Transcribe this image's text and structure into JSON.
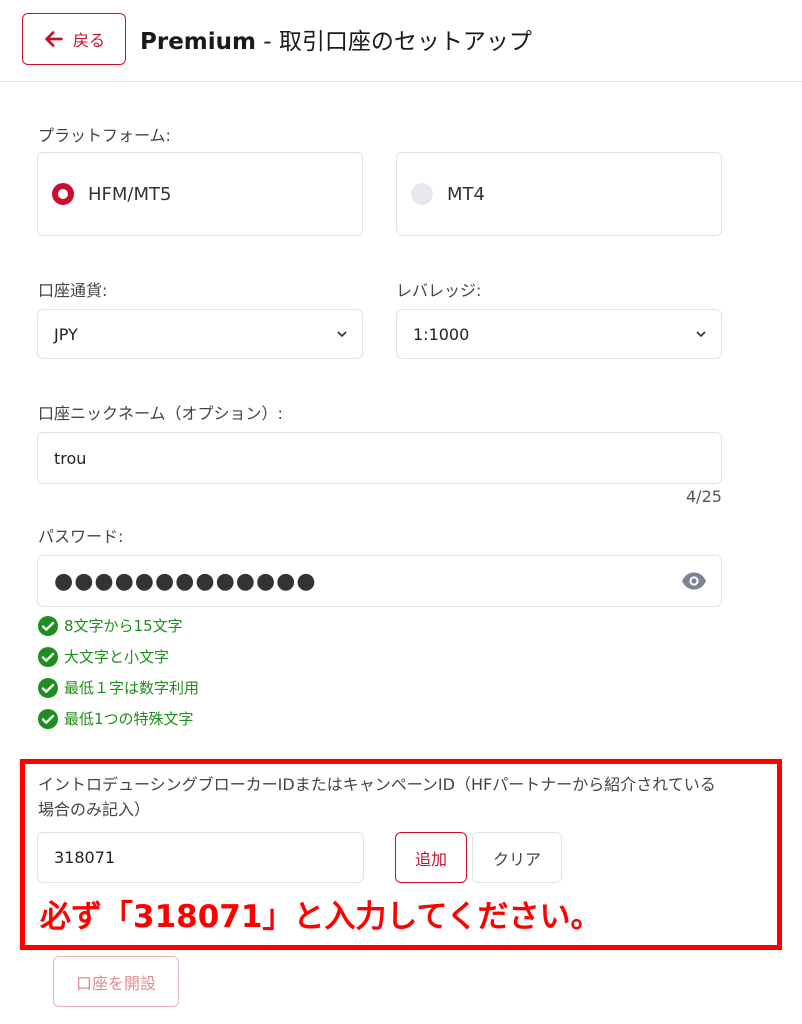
{
  "header": {
    "back_label": "戻る",
    "title_bold": "Premium",
    "title_rest": " - 取引口座のセットアップ"
  },
  "platform": {
    "label": "プラットフォーム:",
    "options": [
      {
        "label": "HFM/MT5",
        "selected": true
      },
      {
        "label": "MT4",
        "selected": false
      }
    ]
  },
  "currency": {
    "label": "口座通貨:",
    "value": "JPY"
  },
  "leverage": {
    "label": "レバレッジ:",
    "value": "1:1000"
  },
  "nickname": {
    "label": "口座ニックネーム（オプション）:",
    "value": "trou",
    "counter": "4/25"
  },
  "password": {
    "label": "パスワード:",
    "value": "●●●●●●●●●●●●●",
    "rules": [
      "8文字から15文字",
      "大文字と小文字",
      "最低１字は数字利用",
      "最低1つの特殊文字"
    ]
  },
  "ib": {
    "label": "イントロデューシングブローカーIDまたはキャンペーンID（HFパートナーから紹介されている場合のみ記入）",
    "value": "318071",
    "add_label": "追加",
    "clear_label": "クリア"
  },
  "annotation": "必ず「318071」と入力してください。",
  "submit_label": "口座を開設",
  "colors": {
    "brand": "#c8102e",
    "success": "#1e8e1e",
    "annotation": "#ff0000"
  }
}
